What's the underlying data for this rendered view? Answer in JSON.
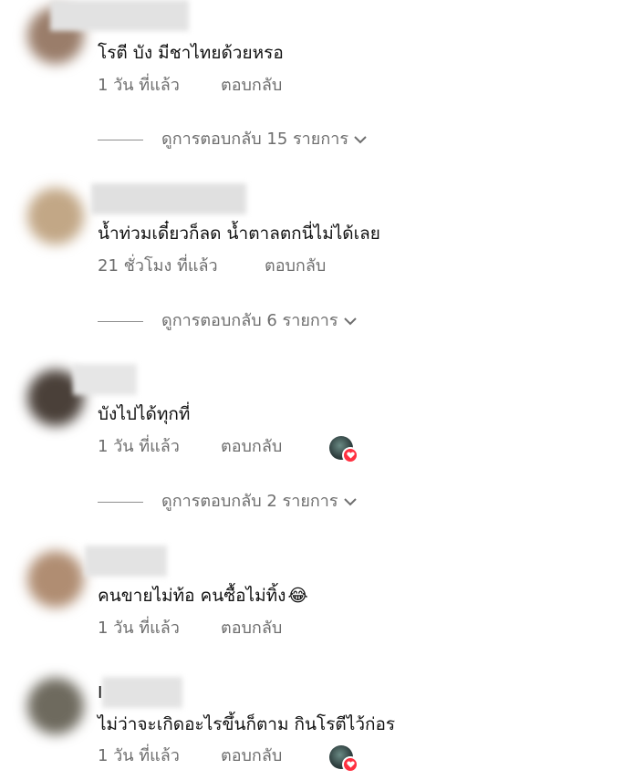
{
  "comments": [
    {
      "text": "โรตี บัง มีชาไทยด้วยหรอ",
      "time": "1 วัน ที่แล้ว",
      "reply": "ตอบกลับ",
      "view_replies": "ดูการตอบกลับ 15 รายการ"
    },
    {
      "text": "น้ำท่วมเดี๋ยวก็ลด น้ำตาลตกนี่ไม่ได้เลย",
      "time": "21 ชั่วโมง ที่แล้ว",
      "reply": "ตอบกลับ",
      "view_replies": "ดูการตอบกลับ 6 รายการ"
    },
    {
      "text": "บังไปได้ทุกที่",
      "time": "1 วัน ที่แล้ว",
      "reply": "ตอบกลับ",
      "view_replies": "ดูการตอบกลับ 2 รายการ",
      "liked_by_author": true
    },
    {
      "text": "คนขายไม่ท้อ คนซื้อไม่ทิ้ง",
      "emoji": "😂",
      "time": "1 วัน ที่แล้ว",
      "reply": "ตอบกลับ"
    },
    {
      "partial_name": "I",
      "text": "ไม่ว่าจะเกิดอะไรขึ้นก็ตาม กินโรตีไว้ก่อร",
      "time": "1 วัน ที่แล้ว",
      "reply": "ตอบกลับ",
      "liked_by_author": true
    }
  ],
  "colors": {
    "text": "#111111",
    "meta": "#6e6e6e",
    "heart": "#ff3040"
  }
}
